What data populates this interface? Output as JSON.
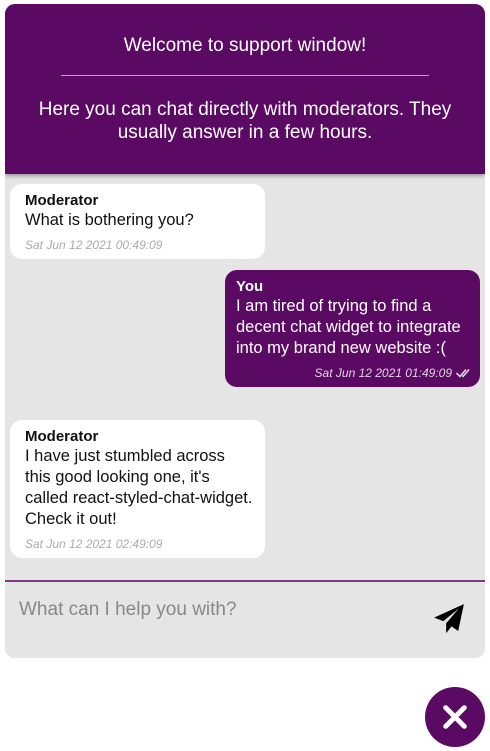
{
  "header": {
    "title": "Welcome to support window!",
    "description": "Here you can chat directly with moderators. They usually answer in a few hours."
  },
  "messages": [
    {
      "author": "Moderator",
      "text": "What is bothering you?",
      "time": "Sat Jun 12 2021 00:49:09",
      "direction": "incoming"
    },
    {
      "author": "You",
      "text": "I am tired of trying to find a decent chat widget to integrate into my brand new website :(",
      "time": "Sat Jun 12 2021 01:49:09",
      "direction": "outgoing",
      "status_icon": "double-check-icon"
    },
    {
      "author": "Moderator",
      "text": "I have just stumbled across this good looking one, it's called react-styled-chat-widget. Check it out!",
      "time": "Sat Jun 12 2021 02:49:09",
      "direction": "incoming"
    }
  ],
  "composer": {
    "placeholder": "What can I help you with?",
    "value": "",
    "send_icon": "paper-plane-icon"
  },
  "launcher": {
    "icon": "close-icon"
  },
  "colors": {
    "brand": "#5a0a63",
    "background": "#e5e5e5",
    "bubble_incoming": "#ffffff"
  }
}
